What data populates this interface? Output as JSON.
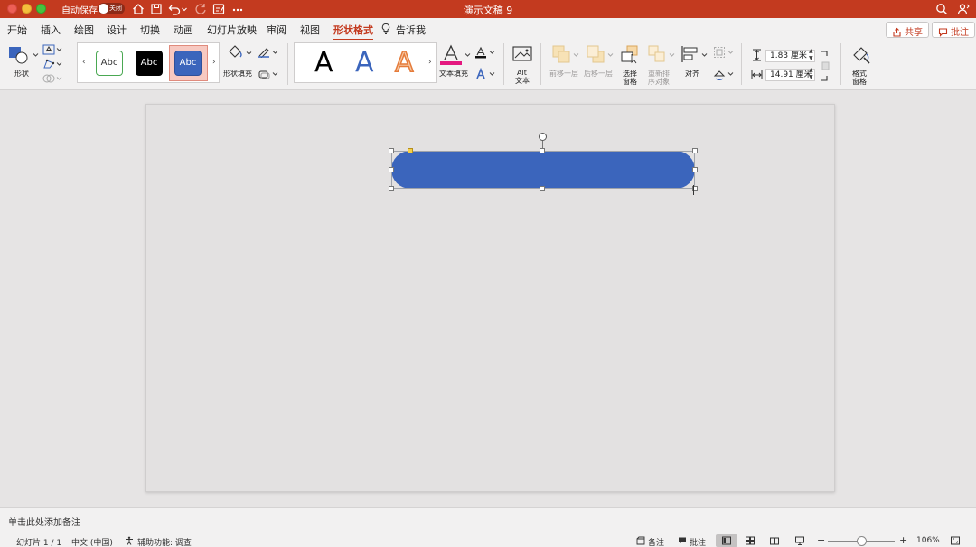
{
  "app": {
    "title": "演示文稿 9",
    "autosave_label": "自动保存",
    "autosave_state": "关闭"
  },
  "tabs": [
    {
      "label": "开始"
    },
    {
      "label": "插入"
    },
    {
      "label": "绘图"
    },
    {
      "label": "设计"
    },
    {
      "label": "切换"
    },
    {
      "label": "动画"
    },
    {
      "label": "幻灯片放映"
    },
    {
      "label": "审阅"
    },
    {
      "label": "视图"
    },
    {
      "label": "形状格式",
      "active": true
    }
  ],
  "tell_me": "告诉我",
  "header_buttons": {
    "share": "共享",
    "comments": "批注"
  },
  "ribbon": {
    "shapes_label": "形状",
    "style_samples": [
      "Abc",
      "Abc",
      "Abc"
    ],
    "shape_fill_label": "形状填充",
    "wordart_samples": [
      "A",
      "A",
      "A"
    ],
    "text_fill_label": "文本填充",
    "alt_text_line1": "Alt",
    "alt_text_line2": "文本",
    "bring_forward": "前移一层",
    "send_backward": "后移一层",
    "selection_pane_line1": "选择",
    "selection_pane_line2": "窗格",
    "reorder_line1": "重新排",
    "reorder_line2": "序对象",
    "align": "对齐",
    "height": "1.83 厘米",
    "width": "14.91 厘米",
    "format_pane_line1": "格式",
    "format_pane_line2": "窗格"
  },
  "colors": {
    "accent": "#c33a1f",
    "shape_fill": "#3b65bc",
    "text_fill_underline": "#e4177f"
  },
  "notes_placeholder": "单击此处添加备注",
  "status": {
    "slide_counter": "幻灯片 1 / 1",
    "language": "中文 (中国)",
    "accessibility": "辅助功能: 调查",
    "notes": "备注",
    "comments": "批注",
    "zoom": "106%"
  }
}
